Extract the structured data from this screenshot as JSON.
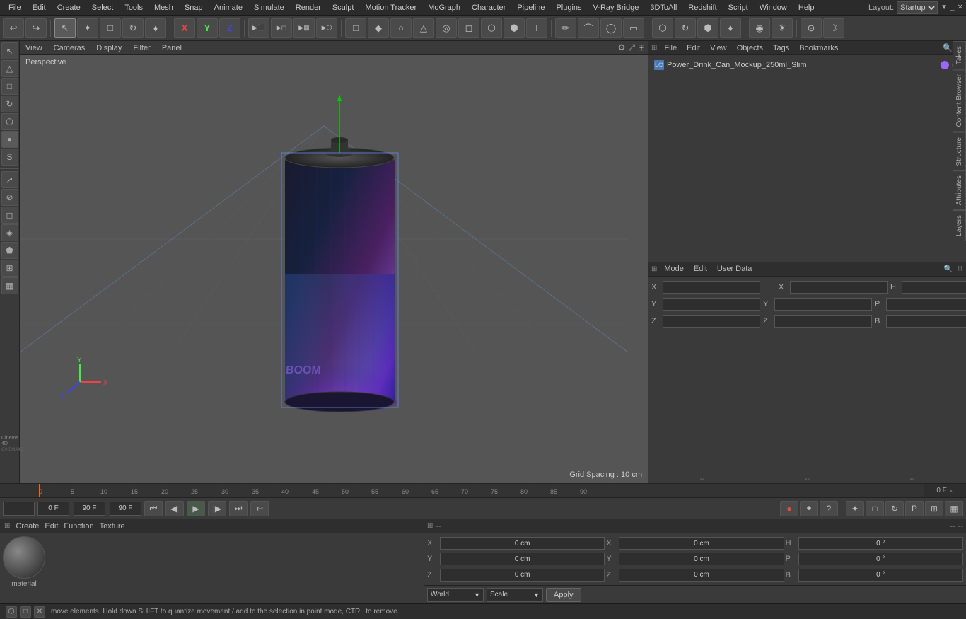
{
  "app": {
    "title": "Cinema 4D"
  },
  "menu": {
    "items": [
      "File",
      "Edit",
      "Create",
      "Select",
      "Tools",
      "Mesh",
      "Snap",
      "Animate",
      "Simulate",
      "Render",
      "Sculpt",
      "Motion Tracker",
      "MoGraph",
      "Character",
      "Pipeline",
      "Plugins",
      "V-Ray Bridge",
      "3DToAll",
      "Redshift",
      "Script",
      "Window",
      "Help"
    ],
    "layout_label": "Layout:",
    "layout_value": "Startup"
  },
  "toolbar": {
    "undo_icon": "↩",
    "redo_icon": "↪",
    "mode_icons": [
      "↖",
      "+",
      "□",
      "↻",
      "✦"
    ],
    "axis_icons": [
      "X",
      "Y",
      "Z"
    ],
    "render_icons": [
      "▶",
      "⬛",
      "⬛",
      "⬛"
    ],
    "object_icons": [
      "□",
      "◆",
      "○",
      "◎",
      "◻",
      "⬡",
      "⬢",
      "♦",
      "○"
    ],
    "misc_icons": [
      "✏",
      "⟳",
      "◉",
      "⬡",
      "△",
      "☽",
      "⊙"
    ]
  },
  "viewport": {
    "menus": [
      "View",
      "Cameras",
      "Display",
      "Filter",
      "Panel"
    ],
    "label": "Perspective",
    "grid_spacing": "Grid Spacing : 10 cm"
  },
  "left_sidebar": {
    "tools": [
      "↖",
      "△",
      "□",
      "↻",
      "⬡",
      "●",
      "◯",
      "S",
      "↗",
      "⊘",
      "◻",
      "◈",
      "⬟"
    ]
  },
  "right_panel_top": {
    "menus": [
      "File",
      "Edit",
      "View",
      "Objects",
      "Tags",
      "Bookmarks"
    ],
    "object_name": "Power_Drink_Can_Mockup_250ml_Slim",
    "search_icon": "🔍"
  },
  "right_panel_tabs": {
    "tabs": [
      "Takes",
      "Content Browser",
      "Structure",
      "Attributes",
      "Layers"
    ]
  },
  "right_panel_bottom": {
    "menus": [
      "Mode",
      "Edit",
      "User Data"
    ],
    "coord_header": "--",
    "coord_header2": "--"
  },
  "timeline": {
    "frame_label": "0 F",
    "ticks": [
      "0",
      "5",
      "10",
      "15",
      "20",
      "25",
      "30",
      "35",
      "40",
      "45",
      "50",
      "55",
      "60",
      "65",
      "70",
      "75",
      "80",
      "85",
      "90"
    ],
    "start_frame": "0 F",
    "end_frame": "90 F",
    "current_frame": "0 F"
  },
  "playback": {
    "start_frame_input": "0 F",
    "current_frame_input": "0 F",
    "end_frame_input": "90 F",
    "end_frame_input2": "90 F",
    "btn_start": "⏮",
    "btn_prev_key": "◀|",
    "btn_play": "▶",
    "btn_next_key": "|▶",
    "btn_end": "⏭",
    "btn_loop": "↩"
  },
  "playback_right": {
    "btn1": "+",
    "btn2": "□",
    "btn3": "↻",
    "btn4": "P",
    "btn5": "⊞",
    "btn6": "▦"
  },
  "material_panel": {
    "menus": [
      "Create",
      "Edit",
      "Function",
      "Texture"
    ],
    "material_name": "material",
    "ball_gradient": "radial-gradient(circle at 35% 35%, #888, #222)"
  },
  "coords": {
    "position_x": "0 cm",
    "position_y": "0 cm",
    "position_z": "0 cm",
    "size_x": "0 cm",
    "size_y": "0 cm",
    "size_z": "0 cm",
    "rotation_h": "0 °",
    "rotation_p": "0 °",
    "rotation_b": "0 °",
    "world_label": "World",
    "scale_label": "Scale",
    "apply_label": "Apply"
  },
  "status_bar": {
    "message": "move elements. Hold down SHIFT to quantize movement / add to the selection in point mode, CTRL to remove."
  }
}
